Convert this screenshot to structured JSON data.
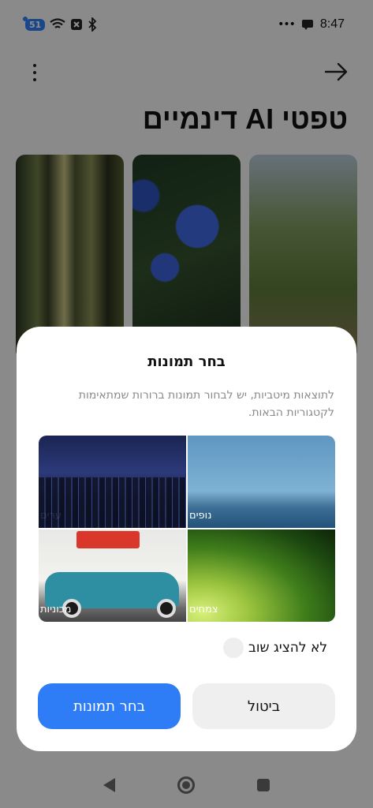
{
  "status_bar": {
    "data_badge": "51",
    "time": "8:47"
  },
  "header": {
    "title": "טפטי AI דינמיים"
  },
  "wallpapers": [
    {
      "name": "forest"
    },
    {
      "name": "flowers"
    },
    {
      "name": "tree"
    }
  ],
  "dialog": {
    "title": "בחר תמונות",
    "description": "לתוצאות מיטביות, יש לבחור תמונות ברורות שמתאימות לקטגוריות הבאות.",
    "categories": [
      {
        "label": "ערים"
      },
      {
        "label": "נופים"
      },
      {
        "label": "מכוניות"
      },
      {
        "label": "צמחים"
      }
    ],
    "dont_show_again": "לא להציג שוב",
    "cancel_label": "ביטול",
    "select_label": "בחר תמונות"
  }
}
